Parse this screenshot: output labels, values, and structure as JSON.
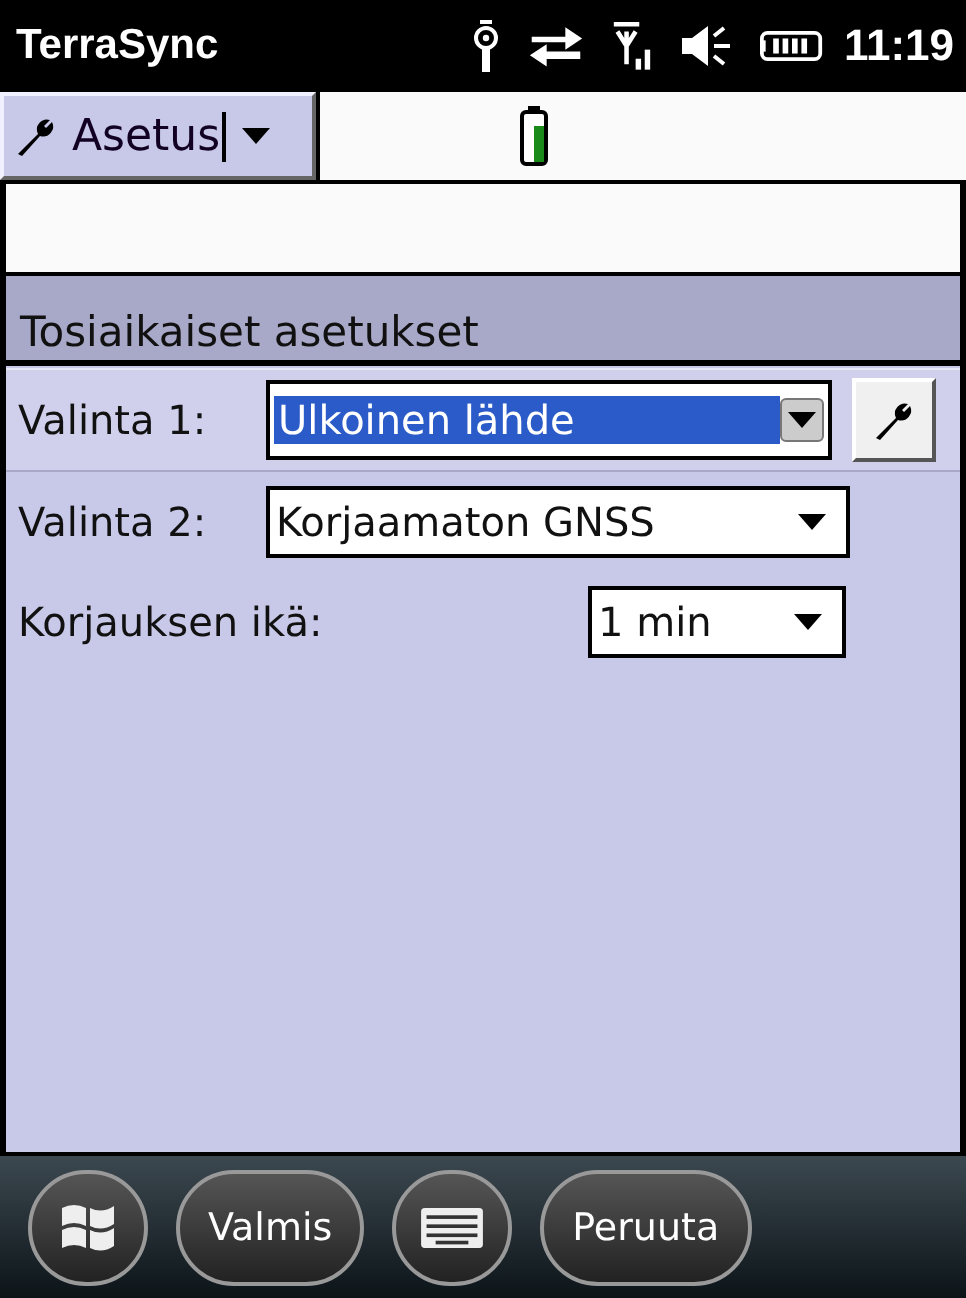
{
  "status_bar": {
    "title": "TerraSync",
    "time": "11:19"
  },
  "toolbar": {
    "menu": {
      "label": "Asetus"
    }
  },
  "panel": {
    "title": "Tosiaikaiset asetukset",
    "rows": [
      {
        "label": "Valinta 1:",
        "value": "Ulkoinen lähde",
        "selected": true,
        "kind": "wide",
        "tool": true
      },
      {
        "label": "Valinta 2:",
        "value": "Korjaamaton GNSS",
        "selected": false,
        "kind": "wide",
        "tool": false
      },
      {
        "label": "Korjauksen ikä:",
        "value": "1 min",
        "selected": false,
        "kind": "narrow",
        "tool": false
      }
    ]
  },
  "softkeys": [
    {
      "kind": "start"
    },
    {
      "kind": "text",
      "label": "Valmis"
    },
    {
      "kind": "keyboard"
    },
    {
      "kind": "text",
      "label": "Peruuta"
    }
  ]
}
